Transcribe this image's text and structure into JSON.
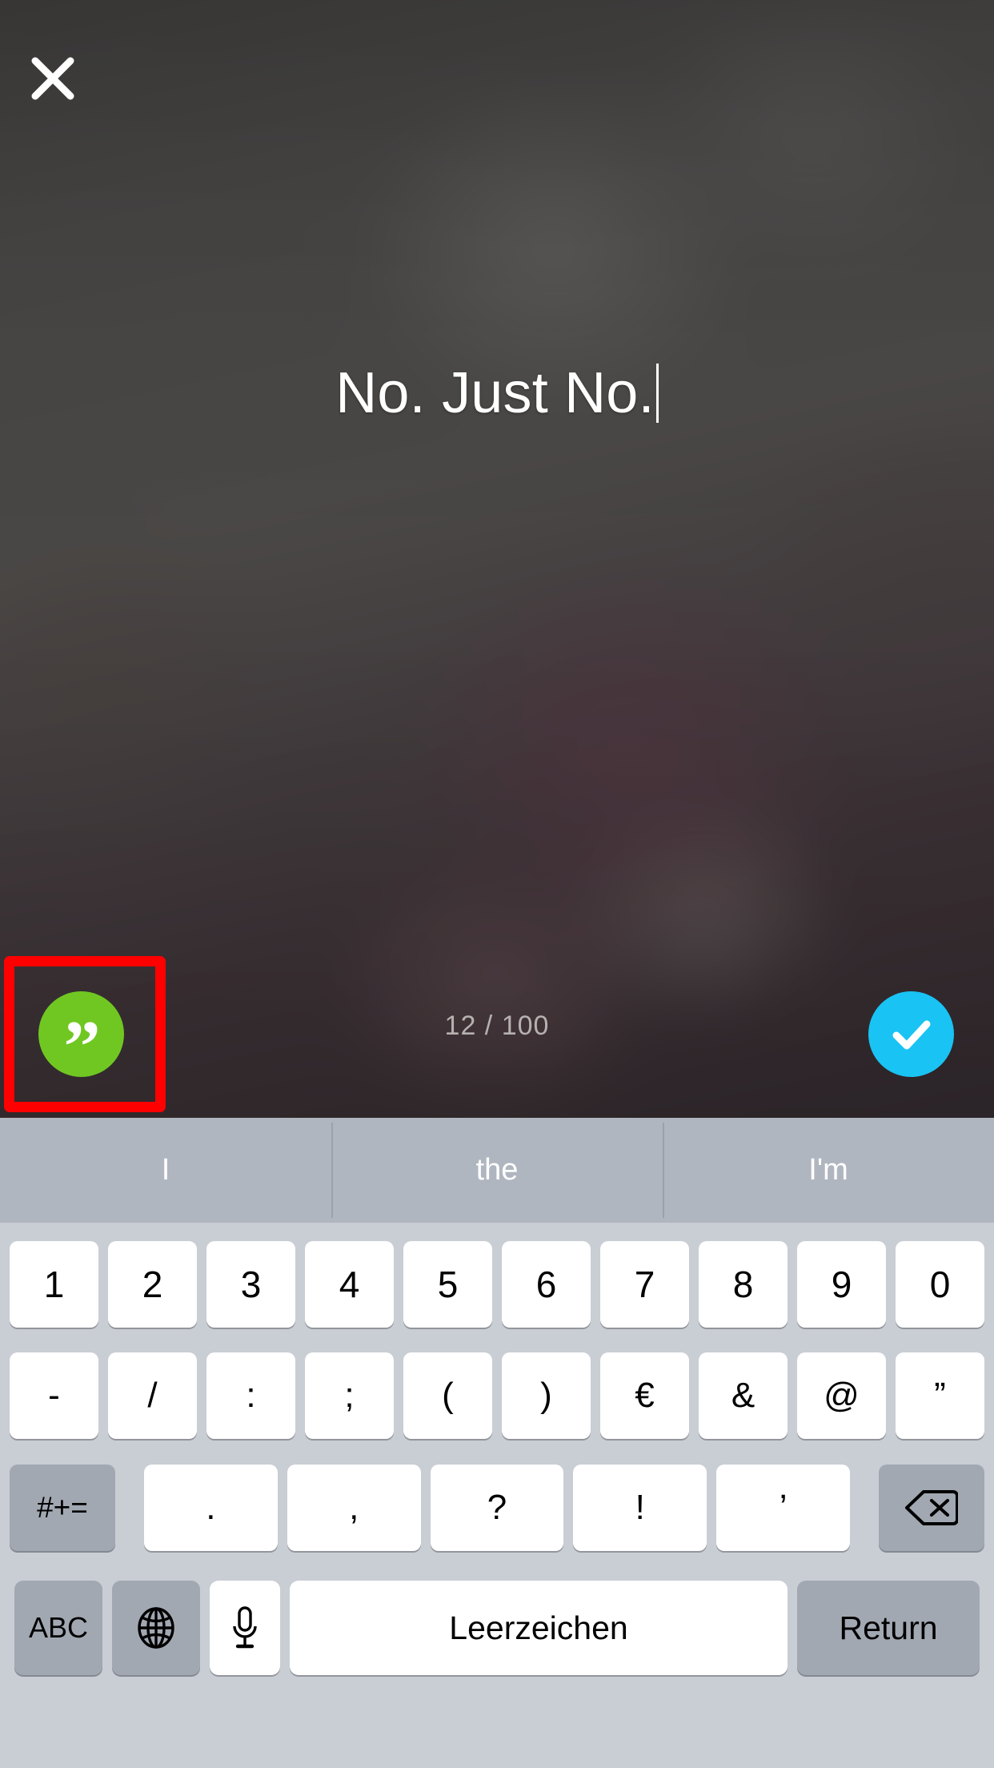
{
  "screen": {
    "app_type": "photo-caption-editor",
    "accent_confirm_color": "#19c3f3",
    "accent_quote_color": "#70c722",
    "highlight_box_color": "#ff0000"
  },
  "photo_area": {
    "close_icon": "close-icon",
    "caption_text": "No. Just No.",
    "char_counter": "12 / 100",
    "quote_button": {
      "icon": "quote-icon",
      "glyph": "”"
    },
    "confirm_button": {
      "icon": "check-icon"
    }
  },
  "keyboard": {
    "language": "de",
    "suggestions": [
      {
        "label": "I"
      },
      {
        "label": "the"
      },
      {
        "label": "I'm"
      }
    ],
    "rows": {
      "numbers": [
        "1",
        "2",
        "3",
        "4",
        "5",
        "6",
        "7",
        "8",
        "9",
        "0"
      ],
      "symbols": [
        "-",
        "/",
        ":",
        ";",
        "(",
        ")",
        "€",
        "&",
        "@",
        "”"
      ],
      "punct": {
        "shift_label": "#+=",
        "keys": [
          ".",
          ",",
          "?",
          "!",
          "’"
        ],
        "delete_icon": "backspace-icon"
      },
      "bottom": {
        "abc_label": "ABC",
        "globe_icon": "globe-icon",
        "mic_icon": "microphone-icon",
        "space_label": "Leerzeichen",
        "return_label": "Return"
      }
    }
  }
}
